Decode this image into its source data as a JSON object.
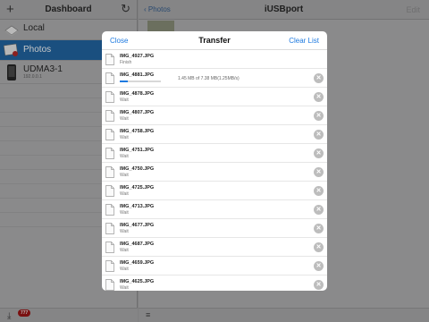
{
  "sidebar": {
    "title": "Dashboard",
    "add_icon": "plus-icon",
    "refresh_icon": "refresh-icon",
    "items": [
      {
        "label": "Local",
        "icon": "drive-icon"
      },
      {
        "label": "Photos",
        "icon": "photos-icon",
        "selected": true
      },
      {
        "label": "UDMA3-1",
        "sublabel": "192.0.0.1",
        "icon": "device-icon"
      }
    ],
    "footer": {
      "badge": "777",
      "icon": "tray-icon"
    }
  },
  "detail": {
    "back_label": "Photos",
    "title": "iUSBport",
    "edit_label": "Edit"
  },
  "transfer": {
    "title": "Transfer",
    "close_label": "Close",
    "clear_label": "Clear List",
    "rows": [
      {
        "name": "IMG_4927.JPG",
        "status": "Finish"
      },
      {
        "name": "IMG_4881.JPG",
        "status": "",
        "progress": 0.2,
        "progress_text": "1.45 MB of 7.38 MB(1.25MB/s)"
      },
      {
        "name": "IMG_4878.JPG",
        "status": "Wait"
      },
      {
        "name": "IMG_4807.JPG",
        "status": "Wait"
      },
      {
        "name": "IMG_4758.JPG",
        "status": "Wait"
      },
      {
        "name": "IMG_4751.JPG",
        "status": "Wait"
      },
      {
        "name": "IMG_4750.JPG",
        "status": "Wait"
      },
      {
        "name": "IMG_4725.JPG",
        "status": "Wait"
      },
      {
        "name": "IMG_4713.JPG",
        "status": "Wait"
      },
      {
        "name": "IMG_4677.JPG",
        "status": "Wait"
      },
      {
        "name": "IMG_4687.JPG",
        "status": "Wait"
      },
      {
        "name": "IMG_4659.JPG",
        "status": "Wait"
      },
      {
        "name": "IMG_4625.JPG",
        "status": "Wait"
      }
    ]
  },
  "colors": {
    "accent": "#1e7ae0",
    "selected_row": "#1a4f7f",
    "badge": "#7a1010"
  }
}
